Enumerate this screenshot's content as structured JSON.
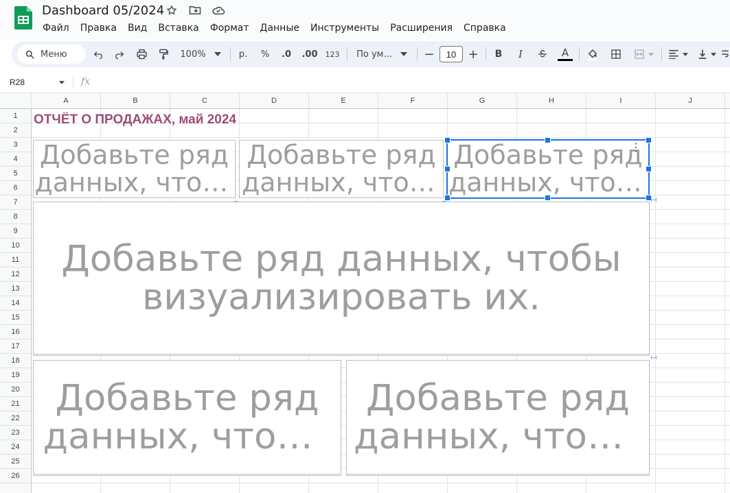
{
  "app": {
    "doc_title": "Dashboard 05/2024",
    "menu": [
      "Файл",
      "Правка",
      "Вид",
      "Вставка",
      "Формат",
      "Данные",
      "Инструменты",
      "Расширения",
      "Справка"
    ]
  },
  "toolbar": {
    "search_label": "Меню",
    "zoom": "100%",
    "currency": "р.",
    "percent": "%",
    "dec_less": ".0",
    "dec_more": ".00",
    "number_format": "123",
    "font_name": "По ум...",
    "font_size": "10",
    "minus": "−",
    "plus": "+",
    "bold": "B",
    "italic": "I",
    "text_color_letter": "A"
  },
  "formula_bar": {
    "cell_ref": "R28",
    "fx": "fx"
  },
  "columns": [
    "A",
    "B",
    "C",
    "D",
    "E",
    "F",
    "G",
    "H",
    "I",
    "J"
  ],
  "rows": [
    "1",
    "2",
    "3",
    "4",
    "5",
    "6",
    "7",
    "8",
    "9",
    "10",
    "11",
    "12",
    "13",
    "14",
    "15",
    "16",
    "17",
    "18",
    "19",
    "20",
    "21",
    "22",
    "23",
    "24",
    "25",
    "26"
  ],
  "sheet": {
    "report_title": "ОТЧЁТ О ПРОДАЖАХ, май 2024"
  },
  "charts": {
    "small_1": {
      "line1": "Добавьте ряд",
      "line2": "данных, чтоб..."
    },
    "small_2": {
      "line1": "Добавьте ряд",
      "line2": "данных, чтоб..."
    },
    "small_3": {
      "line1": "Добавьте ряд",
      "line2": "данных, чтоб..."
    },
    "big": {
      "line1": "Добавьте ряд данных, чтобы",
      "line2": "визуализировать их."
    },
    "half_1": {
      "line1": "Добавьте ряд",
      "line2": "данных, чтобы..."
    },
    "half_2": {
      "line1": "Добавьте ряд",
      "line2": "данных, чтобы..."
    }
  },
  "colors": {
    "title_color": "#9c4d78",
    "selection": "#1a73e8",
    "placeholder_text": "#9e9e9e"
  }
}
